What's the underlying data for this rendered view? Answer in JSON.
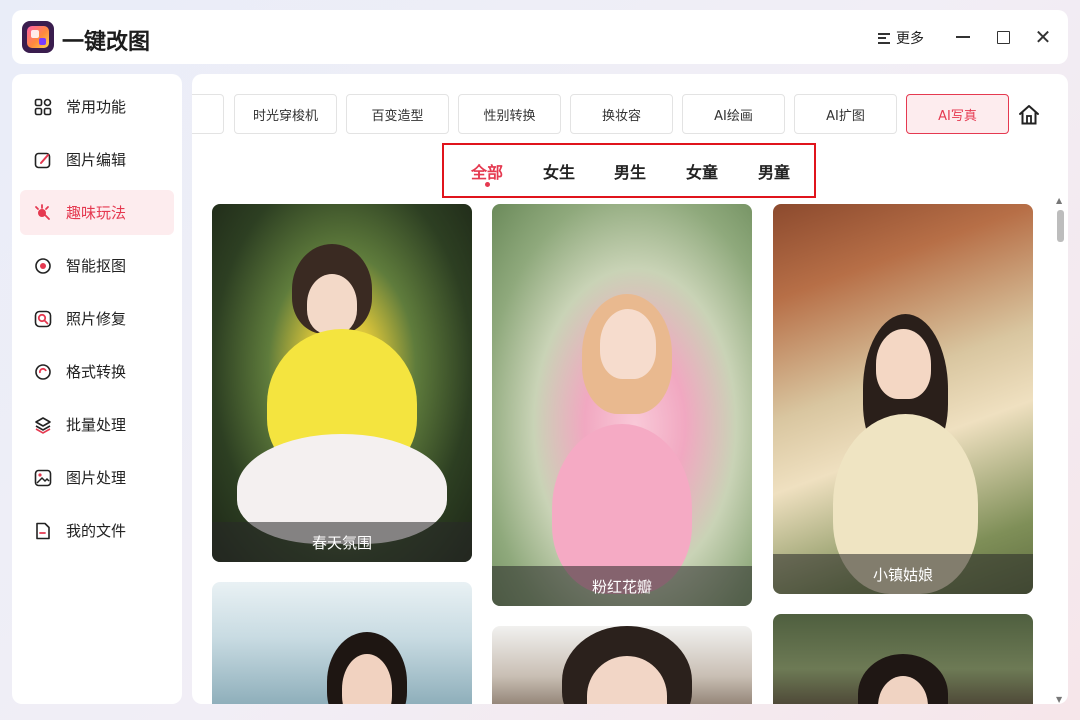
{
  "app": {
    "title": "一键改图",
    "more_label": "更多"
  },
  "sidebar": {
    "items": [
      {
        "label": "常用功能",
        "icon": "grid-icon"
      },
      {
        "label": "图片编辑",
        "icon": "edit-icon"
      },
      {
        "label": "趣味玩法",
        "icon": "sparkle-icon"
      },
      {
        "label": "智能抠图",
        "icon": "target-icon"
      },
      {
        "label": "照片修复",
        "icon": "repair-icon"
      },
      {
        "label": "格式转换",
        "icon": "convert-icon"
      },
      {
        "label": "批量处理",
        "icon": "layers-icon"
      },
      {
        "label": "图片处理",
        "icon": "image-icon"
      },
      {
        "label": "我的文件",
        "icon": "file-icon"
      }
    ],
    "active_index": 2
  },
  "tabs": [
    "时光穿梭机",
    "百变造型",
    "性别转换",
    "换妆容",
    "AI绘画",
    "AI扩图",
    "AI写真"
  ],
  "active_tab": "AI写真",
  "filters": [
    "全部",
    "女生",
    "男生",
    "女童",
    "男童"
  ],
  "active_filter": "全部",
  "cards": [
    {
      "caption": "春天氛围"
    },
    {
      "caption": "粉红花瓣"
    },
    {
      "caption": "小镇姑娘"
    }
  ],
  "colors": {
    "accent": "#e53950",
    "highlight_box": "#e0141c"
  }
}
